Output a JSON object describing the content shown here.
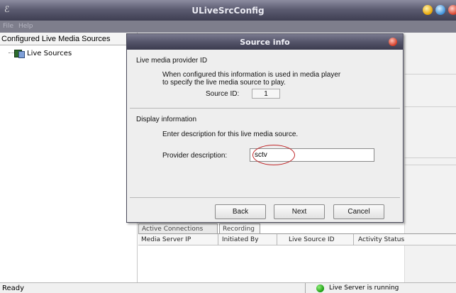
{
  "window": {
    "title": "ULiveSrcConfig",
    "app_icon": "app-icon",
    "menu": [
      "File",
      "Help"
    ]
  },
  "sidebar": {
    "header": "Configured Live Media Sources",
    "items": [
      {
        "label": "Live Sources",
        "icon": "live-sources-icon"
      }
    ]
  },
  "tabs": [
    "Active Connections",
    "Recording"
  ],
  "table": {
    "columns": [
      "Media Server IP",
      "Initiated By",
      "Live Source ID",
      "Activity Status"
    ]
  },
  "status": {
    "left": "Ready",
    "right": "Live Server is running"
  },
  "dialog": {
    "title": "Source info",
    "section1_title": "Live media provider ID",
    "section1_desc": [
      "When configured this information is used in media player",
      "to specify the live media source to play."
    ],
    "source_id_label": "Source ID:",
    "source_id_value": "1",
    "section2_title": "Display information",
    "section2_desc": "Enter description for this live media source.",
    "provider_label": "Provider description:",
    "provider_value": "sctv",
    "buttons": {
      "back": "Back",
      "next": "Next",
      "cancel": "Cancel"
    }
  },
  "colors": {
    "titlebar": "#5d5d72",
    "annotation": "#c0282a",
    "status_ok": "#1a9a10"
  }
}
